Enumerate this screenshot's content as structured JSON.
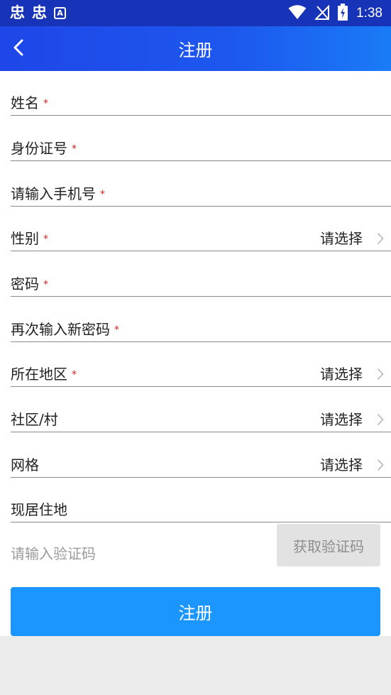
{
  "status_bar": {
    "left_glyphs": [
      "忠",
      "忠"
    ],
    "a_icon_letter": "A",
    "time": "1:38",
    "icons": [
      "wifi-icon",
      "no-signal-icon",
      "battery-charging-icon"
    ]
  },
  "header": {
    "title": "注册",
    "back_icon": "chevron-left-icon"
  },
  "form": {
    "fields": [
      {
        "label": "姓名",
        "required_mark": "*"
      },
      {
        "label": "身份证号",
        "required_mark": "*"
      },
      {
        "label": "请输入手机号",
        "required_mark": "*"
      },
      {
        "label": "性别",
        "required_mark": "*",
        "select": "请选择"
      },
      {
        "label": "密码",
        "required_mark": "*"
      },
      {
        "label": "再次输入新密码",
        "required_mark": "*"
      },
      {
        "label": "所在地区",
        "required_mark": "*",
        "select": "请选择"
      },
      {
        "label": "社区/村",
        "required_mark": "",
        "select": "请选择"
      },
      {
        "label": "网格",
        "required_mark": "",
        "select": "请选择"
      },
      {
        "label": "现居住地",
        "required_mark": ""
      }
    ],
    "code_input_placeholder": "请输入验证码",
    "get_code_label": "获取验证码",
    "submit_label": "注册"
  },
  "colors": {
    "status_bar": "#1733b8",
    "header_start": "#1e46e8",
    "header_end": "#1a7bf7",
    "required": "#e02020",
    "submit": "#1b95ff",
    "code_button_bg": "#e2e2e2"
  }
}
